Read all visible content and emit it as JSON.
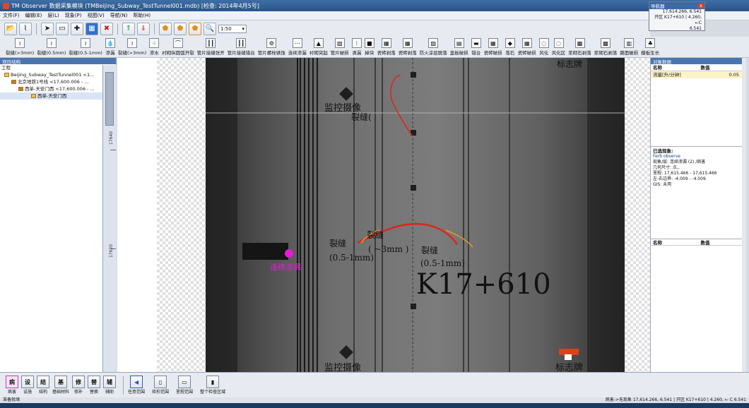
{
  "window": {
    "title": "TM Observer 数据采集模块 (TMBeijing_Subway_TestTunnel001.mdb) [检查: 2014年4月5号]"
  },
  "menu": [
    "文件(F)",
    "编辑(E)",
    "层(L)",
    "现象(P)",
    "视图(V)",
    "导航(N)",
    "帮助(H)"
  ],
  "toolbar": {
    "zoom_value": "1:50"
  },
  "tools": [
    {
      "label": "裂缝(>3mm)",
      "icon": "crack-icon"
    },
    {
      "label": "裂缝(0.5mm)",
      "icon": "crack-icon"
    },
    {
      "label": "裂缝(0.5-1mm)",
      "icon": "crack-icon"
    },
    {
      "label": "渗漏",
      "icon": "drop-icon"
    },
    {
      "label": "裂缝(>3mm)",
      "icon": "crack-icon"
    },
    {
      "label": "渗水",
      "icon": "water-icon"
    },
    {
      "label": "衬砌纵圆弧开裂",
      "icon": "arc-icon"
    },
    {
      "label": "管片接缝张开",
      "icon": "seam-icon"
    },
    {
      "label": "管片接缝错台",
      "icon": "seam-icon"
    },
    {
      "label": "管片螺栓锈蚀",
      "icon": "bolt-icon"
    },
    {
      "label": "连续渗漏",
      "icon": "leak-icon"
    },
    {
      "label": "衬砌突起",
      "icon": "bump-icon"
    },
    {
      "label": "管片破损",
      "icon": "break-icon"
    },
    {
      "label": "滴漏",
      "icon": "drip-icon"
    },
    {
      "label": "掉块",
      "icon": "block-icon"
    },
    {
      "label": "瓷砖剥落",
      "icon": "tile-icon"
    },
    {
      "label": "瓷砖剥落",
      "icon": "tile-icon"
    },
    {
      "label": "防火涂层脱落",
      "icon": "fire-icon"
    },
    {
      "label": "盖板破损",
      "icon": "cover-icon"
    },
    {
      "label": "错台",
      "icon": "step-icon"
    },
    {
      "label": "瓷砖破损",
      "icon": "tile-icon"
    },
    {
      "label": "落石",
      "icon": "rock-icon"
    },
    {
      "label": "瓷砖破损",
      "icon": "tile-icon"
    },
    {
      "label": "风化",
      "icon": "weather-icon"
    },
    {
      "label": "风化区",
      "icon": "weather-icon"
    },
    {
      "label": "浆砌石剥落",
      "icon": "masonry-icon"
    },
    {
      "label": "浆砌石剥落",
      "icon": "masonry-icon"
    },
    {
      "label": "路面破损",
      "icon": "road-icon"
    },
    {
      "label": "模板生长",
      "icon": "grow-icon"
    }
  ],
  "navigator": {
    "title": "导航器",
    "line1": "17,614.266, 6.541",
    "line2": "开区 K17+610 | 4.260, ←C",
    "line3": "6.541"
  },
  "left_panel": {
    "title": "项目结构",
    "root": "工程",
    "items": [
      "Beijing_Subway_TestTunnel001 <1...",
      "北京地铁1号线 <17,600.006 - ...",
      "西单-天安门西 <17,600.006 - ...",
      "西单-天安门西"
    ],
    "ruler_labels": [
      "17640",
      "17620"
    ]
  },
  "canvas": {
    "labels": {
      "camera_top": "监控摄像",
      "camera_bottom": "监控摄像",
      "crack_top": "裂缝(",
      "crack_a": "裂缝",
      "crack_a_width": "(0.5-1mm)",
      "crack_b": "裂缝",
      "crack_b_width": "( ~3mm )",
      "crack_c": "裂缝",
      "crack_c_width": "(0.5-1mm)",
      "leak": "连续渗漏",
      "mileage": "K17+610",
      "sign_top": "标志牌",
      "sign_bottom": "标志牌"
    },
    "colors": {
      "crack_red": "#e0241b",
      "crack_orange": "#e09a2b",
      "leak_magenta": "#e81ad8",
      "sign_red": "#e0401b"
    }
  },
  "right_panel": {
    "title": "对象数据",
    "col_name": "名称",
    "col_value": "数值",
    "row_name": "流量[升/分钟]",
    "row_value": "0.05",
    "info_title": "已选现象:",
    "info_lines": [
      "Ferb   observe",
      "现象/层: 连续渗漏 (2) /病害",
      "几何尺寸: 点,,",
      "里程: 17,615.466 - 17,615.466",
      "左-右边界: -4.009 - -4.009",
      "GIS: 未用"
    ],
    "col_name2": "名称",
    "col_value2": "数值"
  },
  "bottom_tools": [
    {
      "short": "病",
      "label": "病害",
      "selected": true
    },
    {
      "short": "设",
      "label": "设施",
      "selected": false
    },
    {
      "short": "结",
      "label": "结构",
      "selected": false
    },
    {
      "short": "基",
      "label": "基础材料",
      "selected": false
    },
    {
      "short": "修",
      "label": "修补",
      "selected": false
    },
    {
      "short": "替",
      "label": "替换",
      "selected": false
    },
    {
      "short": "辅",
      "label": "辅助",
      "selected": false
    }
  ],
  "bottom_modes": [
    {
      "label": "任意范围",
      "icon": "cursor-icon"
    },
    {
      "label": "矩形范围",
      "icon": "rect-icon"
    },
    {
      "label": "里程范围",
      "icon": "range-icon"
    },
    {
      "label": "整个检查区域",
      "icon": "area-icon"
    }
  ],
  "status": {
    "left": "准备就绪",
    "right": "病害->无现象  17,614.266, 6.541 | 开区 K17+610 | 4.260, ← C 6.541"
  }
}
